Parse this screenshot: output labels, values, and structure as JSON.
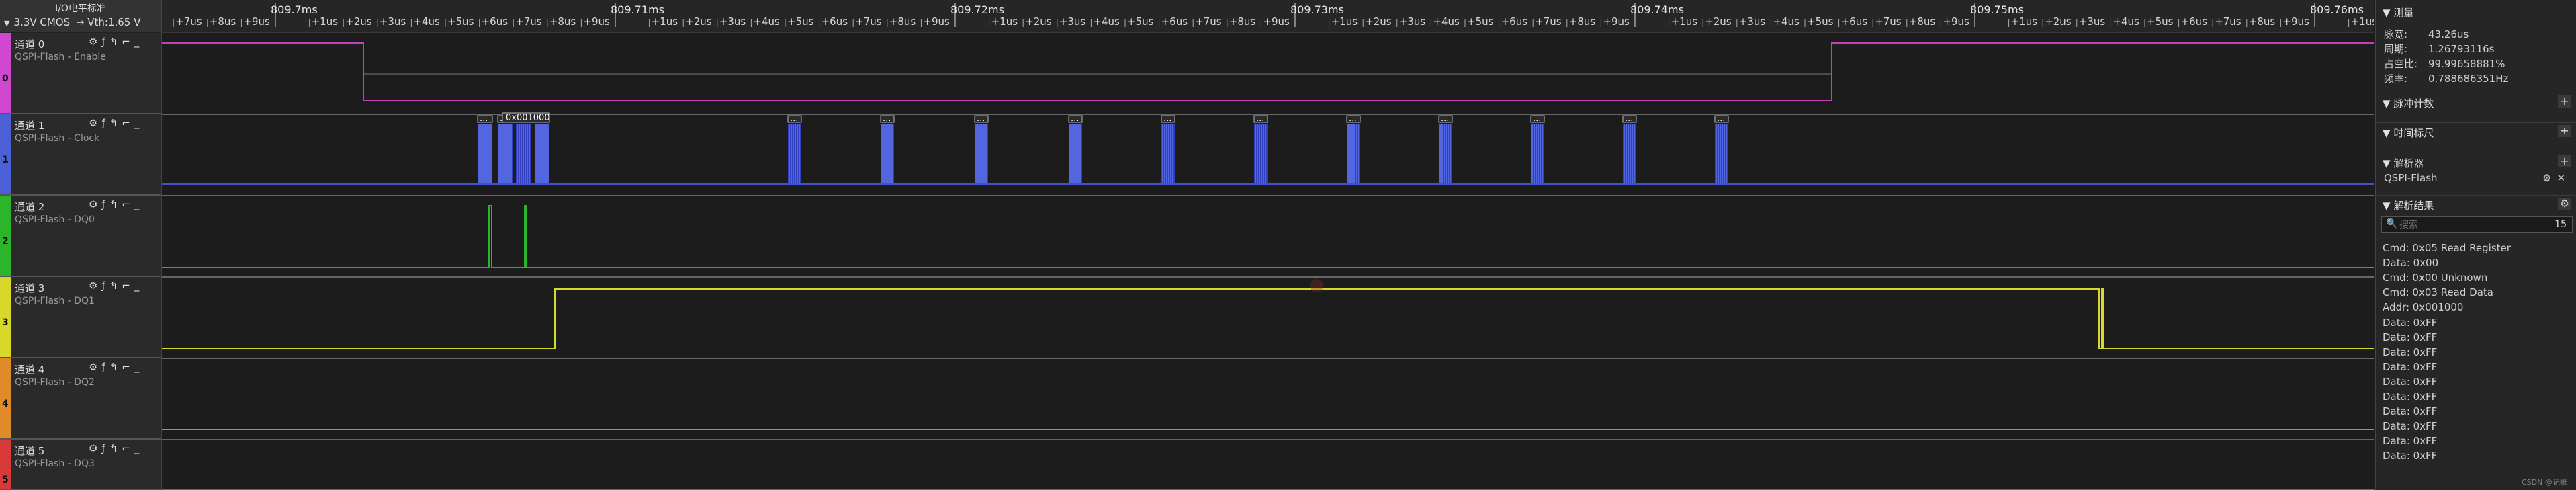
{
  "header": {
    "io_title": "I/O电平标准",
    "io_standard": "3.3V CMOS",
    "vth": "Vth:1.65 V"
  },
  "channels": [
    {
      "id": "0",
      "title": "通道 0",
      "signal": "QSPI-Flash - Enable",
      "color": "#d048d0"
    },
    {
      "id": "1",
      "title": "通道 1",
      "signal": "QSPI-Flash - Clock",
      "color": "#4b5fd6"
    },
    {
      "id": "2",
      "title": "通道 2",
      "signal": "QSPI-Flash - DQ0",
      "color": "#2bb52b"
    },
    {
      "id": "3",
      "title": "通道 3",
      "signal": "QSPI-Flash - DQ1",
      "color": "#d8d82a"
    },
    {
      "id": "4",
      "title": "通道 4",
      "signal": "QSPI-Flash - DQ2",
      "color": "#e08a2a"
    },
    {
      "id": "5",
      "title": "通道 5",
      "signal": "QSPI-Flash - DQ3",
      "color": "#d83a3a"
    }
  ],
  "timeline": {
    "majors": [
      "809.7ms",
      "809.71ms",
      "809.72ms",
      "809.73ms",
      "809.74ms",
      "809.75ms",
      "809.76ms"
    ],
    "minors": [
      "+1us",
      "+2us",
      "+3us",
      "+4us",
      "+5us",
      "+6us",
      "+7us",
      "+8us",
      "+9us"
    ],
    "lead_minors": [
      "+7us",
      "+8us",
      "+9us"
    ]
  },
  "clock_annotation": "0x001000",
  "burst_tag": "...",
  "measure": {
    "title": "测量",
    "rows": [
      {
        "k": "脉宽:",
        "v": "43.26us"
      },
      {
        "k": "周期:",
        "v": "1.26793116s"
      },
      {
        "k": "占空比:",
        "v": "99.99658881%"
      },
      {
        "k": "频率:",
        "v": "0.788686351Hz"
      }
    ]
  },
  "sections": {
    "pulse_count": "脉冲计数",
    "time_ruler": "时间标尺",
    "analyzer": "解析器",
    "analyzer_item": "QSPI-Flash",
    "results": "解析结果"
  },
  "search": {
    "placeholder": "搜索",
    "count": "15"
  },
  "results": [
    "Cmd: 0x05 Read Register",
    "Data: 0x00",
    "Cmd: 0x00 Unknown",
    "Cmd: 0x03 Read Data",
    "Addr: 0x001000",
    "Data: 0xFF",
    "Data: 0xFF",
    "Data: 0xFF",
    "Data: 0xFF",
    "Data: 0xFF",
    "Data: 0xFF",
    "Data: 0xFF",
    "Data: 0xFF",
    "Data: 0xFF",
    "Data: 0xFF"
  ],
  "watermark": "CSDN @记账"
}
